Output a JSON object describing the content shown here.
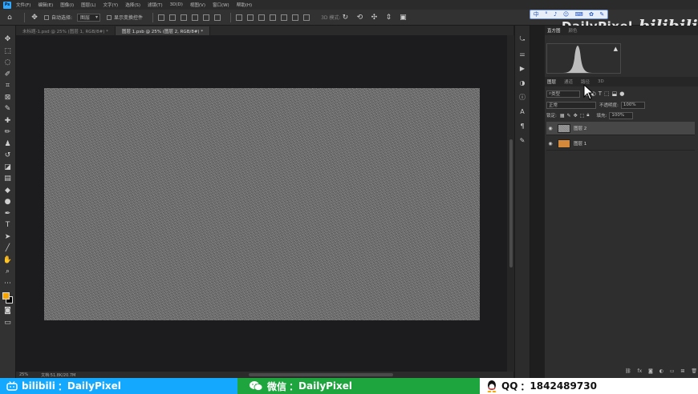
{
  "menubar": {
    "app_icon": "Ps",
    "items": [
      "文件(F)",
      "编辑(E)",
      "图像(I)",
      "图层(L)",
      "文字(Y)",
      "选择(S)",
      "滤镜(T)",
      "3D(D)",
      "视图(V)",
      "窗口(W)",
      "帮助(H)"
    ]
  },
  "options": {
    "auto_select_label": "自动选择:",
    "auto_select_value": "图层",
    "show_transform_label": "显示变换控件",
    "mode_3d_label": "3D 模式:"
  },
  "tabs": [
    {
      "label": "未标题-1.psd @ 25% (图层 1, RGB/8#) *",
      "active": false
    },
    {
      "label": "图层 1.psb @ 25% (图层 2, RGB/8#) *",
      "active": true
    }
  ],
  "status": {
    "zoom": "25%",
    "doc_info": "文档:51.8K/20.7M"
  },
  "right_panel": {
    "top_tabs": [
      "直方图",
      "颜色"
    ],
    "layer_tabs": [
      "图层",
      "通道",
      "路径",
      "3D"
    ],
    "filter_label": "类型",
    "blend_mode": "正常",
    "opacity_label": "不透明度:",
    "opacity_value": "100%",
    "lock_label": "锁定:",
    "fill_label": "填充:",
    "fill_value": "100%",
    "layers": [
      {
        "name": "图层 2",
        "selected": true,
        "thumb": "noise"
      },
      {
        "name": "图层 1",
        "selected": false,
        "thumb": "smart-object"
      }
    ]
  },
  "watermark": {
    "brand": "DailyPixel",
    "site": "bilibili",
    "icon_row": [
      "中",
      "°",
      "♪",
      "☺",
      "⌨",
      "✿",
      "✎"
    ]
  },
  "banner": {
    "bilibili": {
      "label": "bilibili",
      "sep": "：",
      "value": "DailyPixel"
    },
    "wechat": {
      "label": "微信",
      "sep": "：",
      "value": "DailyPixel"
    },
    "qq": {
      "label": "QQ",
      "sep": "：",
      "value": "1842489730"
    }
  },
  "colors": {
    "foreground": "#f7a400",
    "background": "#000000",
    "bilibili_blue": "#14a9ff",
    "wechat_green": "#1ea53e"
  }
}
